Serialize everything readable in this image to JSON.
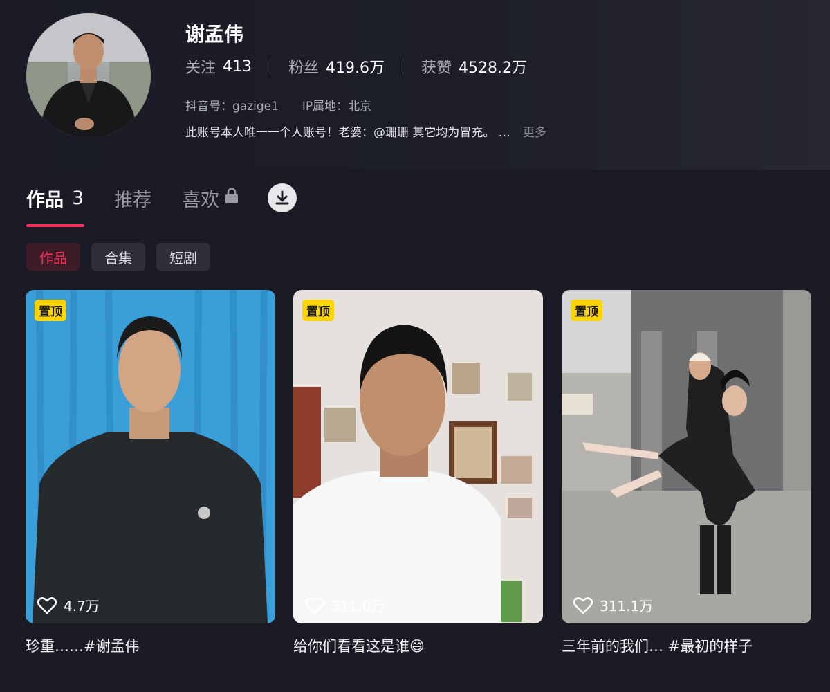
{
  "profile": {
    "name": "谢孟伟",
    "stats": [
      {
        "label": "关注",
        "value": "413"
      },
      {
        "label": "粉丝",
        "value": "419.6万"
      },
      {
        "label": "获赞",
        "value": "4528.2万"
      }
    ],
    "douyin_id": "抖音号：gazige1",
    "ip_location": "IP属地：北京",
    "bio": "此账号本人唯一一个人账号！老婆：@珊珊 其它均为冒充。 …",
    "more_label": "更多"
  },
  "tabs": [
    {
      "label": "作品",
      "count": "3"
    },
    {
      "label": "推荐"
    },
    {
      "label": "喜欢"
    }
  ],
  "chips": [
    "作品",
    "合集",
    "短剧"
  ],
  "videos": [
    {
      "pin": "置顶",
      "likes": "4.7万",
      "title": "珍重……#谢孟伟"
    },
    {
      "pin": "置顶",
      "likes": "311.0万",
      "title": "给你们看看这是谁😄"
    },
    {
      "pin": "置顶",
      "likes": "311.1万",
      "title": "三年前的我们… #最初的样子"
    }
  ],
  "colors": {
    "background": "#1b1b26",
    "accent": "#fe2c55",
    "pin_badge": "#fcd401"
  },
  "icons": [
    "lock-icon",
    "download-icon",
    "heart-icon"
  ]
}
